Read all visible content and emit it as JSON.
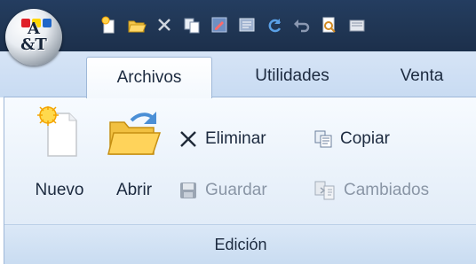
{
  "app": {
    "logo_text_line1": "A",
    "logo_text_line2": "&T"
  },
  "quick_access": [
    {
      "name": "new-icon"
    },
    {
      "name": "open-icon"
    },
    {
      "name": "delete-icon"
    },
    {
      "name": "copy-icon"
    },
    {
      "name": "edit-icon"
    },
    {
      "name": "form-icon"
    },
    {
      "name": "refresh-icon"
    },
    {
      "name": "undo-icon"
    },
    {
      "name": "print-preview-icon"
    },
    {
      "name": "settings-icon"
    }
  ],
  "tabs": [
    {
      "label": "Archivos",
      "active": true
    },
    {
      "label": "Utilidades",
      "active": false
    },
    {
      "label": "Venta",
      "active": false
    }
  ],
  "ribbon": {
    "group_label": "Edición",
    "buttons": {
      "nuevo": "Nuevo",
      "abrir": "Abrir",
      "eliminar": "Eliminar",
      "copiar": "Copiar",
      "guardar": "Guardar",
      "cambiados": "Cambiados"
    },
    "disabled": [
      "Guardar",
      "Cambiados"
    ]
  },
  "colors": {
    "titlebar": "#203654",
    "tabs_bg": "#cfdff4",
    "panel_bg": "#eaf2fb",
    "text": "#1c2a3f",
    "disabled_text": "#8a96a6"
  }
}
